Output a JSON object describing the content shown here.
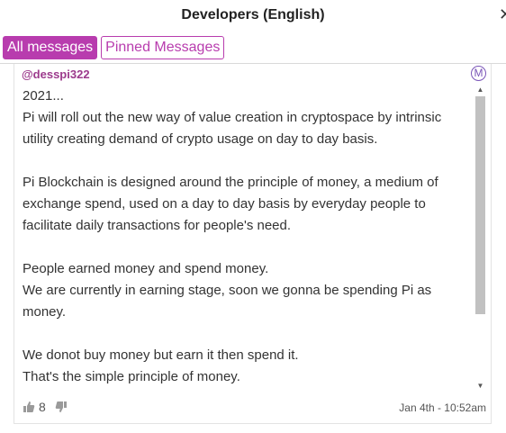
{
  "header": {
    "title": "Developers (English)"
  },
  "tabs": [
    {
      "label": "All messages",
      "active": true
    },
    {
      "label": "Pinned Messages",
      "active": false
    }
  ],
  "message": {
    "author": "@desspi322",
    "badge": "M",
    "lines": [
      "2021...",
      "Pi will roll out the new way of value creation in cryptospace by intrinsic",
      "utility creating demand of crypto usage on day to day basis.",
      "",
      "Pi Blockchain is designed around the principle of money, a medium of",
      "exchange spend, used on a day to day basis by everyday people to",
      "facilitate daily transactions for people's need.",
      "",
      "People earned money and spend money.",
      "We are currently in earning stage, soon we gonna be spending Pi as",
      "money.",
      "",
      "We donot buy money but earn it then spend it.",
      "That's the simple principle of money."
    ],
    "likes": "8",
    "timestamp": "Jan 4th - 10:52am"
  },
  "colors": {
    "accent": "#b83cae",
    "author": "#9c3a8c",
    "badge": "#7a55b8"
  },
  "icons": [
    "close-icon",
    "moderator-badge-icon",
    "thumbs-up-icon",
    "thumbs-down-icon",
    "scroll-up-arrow-icon",
    "scroll-down-arrow-icon"
  ]
}
